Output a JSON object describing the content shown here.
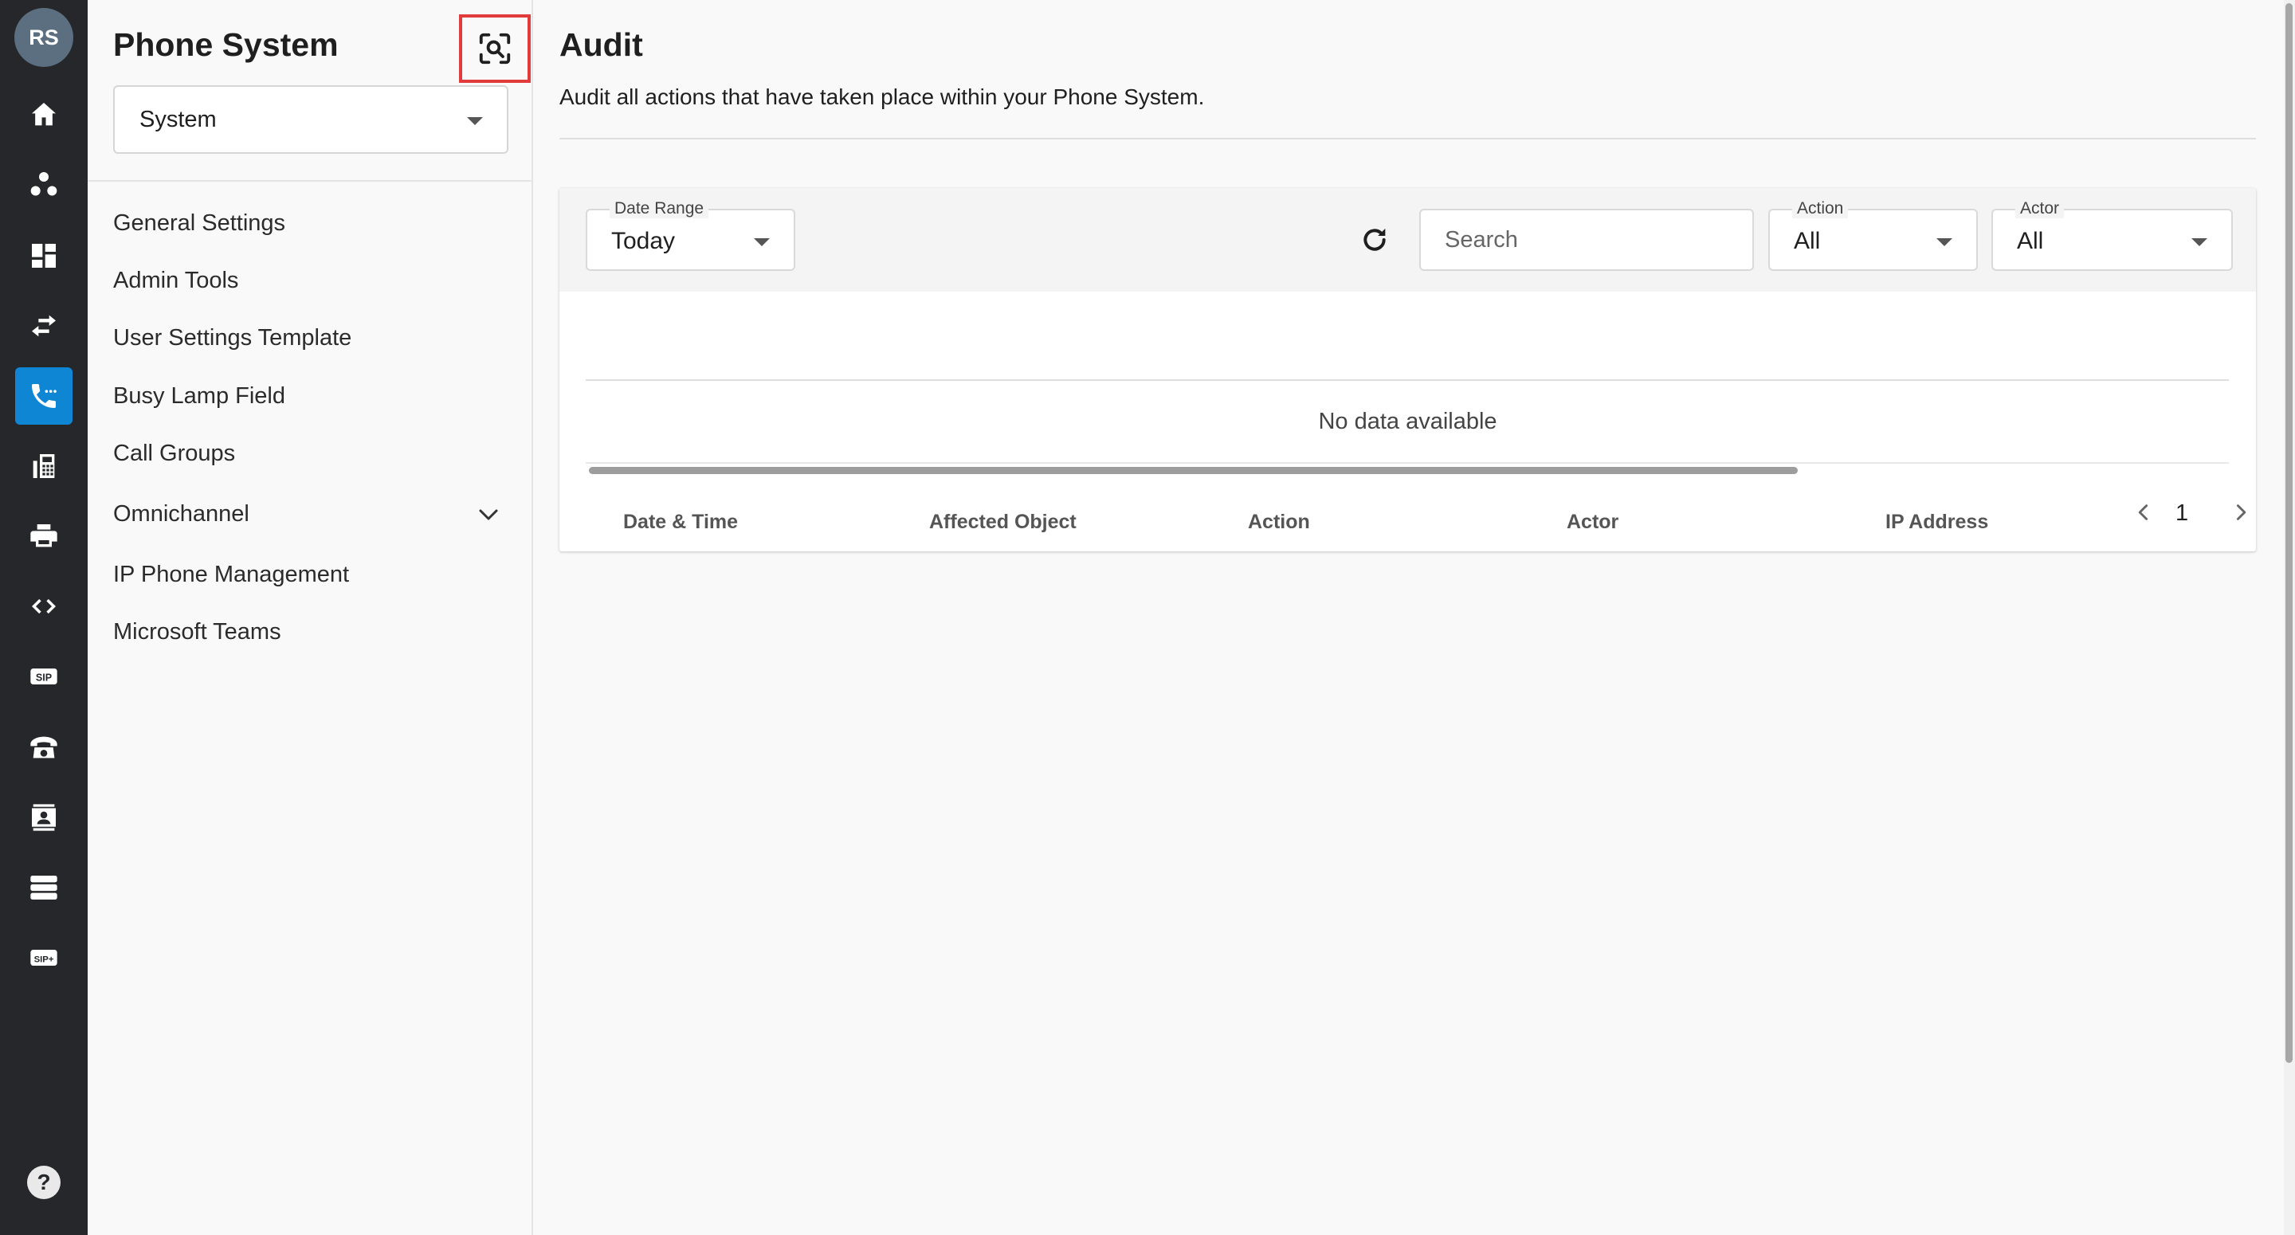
{
  "rail": {
    "avatar_initials": "RS",
    "items": [
      {
        "icon": "home-icon"
      },
      {
        "icon": "users-group-icon"
      },
      {
        "icon": "dashboard-icon"
      },
      {
        "icon": "transfer-arrows-icon"
      },
      {
        "icon": "phone-system-icon",
        "active": true
      },
      {
        "icon": "fax-machine-icon"
      },
      {
        "icon": "printer-icon"
      },
      {
        "icon": "code-icon"
      },
      {
        "icon": "sip-icon",
        "label": "SIP"
      },
      {
        "icon": "desk-phone-icon"
      },
      {
        "icon": "contact-card-icon"
      },
      {
        "icon": "server-list-icon"
      },
      {
        "icon": "sip-plus-icon",
        "label": "SIP+"
      }
    ],
    "help_label": "?"
  },
  "sidebar": {
    "title": "Phone System",
    "selector_value": "System",
    "items": [
      {
        "label": "General Settings"
      },
      {
        "label": "Admin Tools"
      },
      {
        "label": "User Settings Template"
      },
      {
        "label": "Busy Lamp Field"
      },
      {
        "label": "Call Groups"
      },
      {
        "label": "Omnichannel",
        "expandable": true
      },
      {
        "label": "IP Phone Management"
      },
      {
        "label": "Microsoft Teams"
      }
    ]
  },
  "main": {
    "title": "Audit",
    "subtitle": "Audit all actions that have taken place within your Phone System.",
    "filters": {
      "date_range": {
        "label": "Date Range",
        "value": "Today"
      },
      "search": {
        "placeholder": "Search"
      },
      "action": {
        "label": "Action",
        "value": "All"
      },
      "actor": {
        "label": "Actor",
        "value": "All"
      }
    },
    "table": {
      "columns": [
        "Date & Time",
        "Affected Object",
        "Action",
        "Actor",
        "IP Address"
      ],
      "empty_text": "No data available"
    },
    "pagination": {
      "current_page": "1"
    }
  },
  "colors": {
    "rail_bg": "#25272a",
    "accent": "#0e86d4",
    "highlight_border": "#e23b3b",
    "page_bg": "#f9f9f9"
  }
}
